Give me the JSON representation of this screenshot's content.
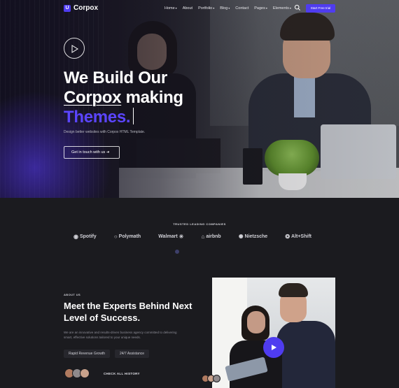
{
  "nav": {
    "logo_mark": "U",
    "logo": "Corpox",
    "items": [
      {
        "label": "Home",
        "dropdown": true
      },
      {
        "label": "About",
        "dropdown": false
      },
      {
        "label": "Portfolio",
        "dropdown": true
      },
      {
        "label": "Blog",
        "dropdown": true
      },
      {
        "label": "Contact",
        "dropdown": false
      },
      {
        "label": "Pages",
        "dropdown": true
      },
      {
        "label": "Elements",
        "dropdown": true
      }
    ],
    "cta": "Start Free trial"
  },
  "hero": {
    "line1": "We Build Our",
    "line2_underlined": "Corpox",
    "line2_rest": " making",
    "line3": "Themes.",
    "subtitle": "Design better websites with Corpox HTML Template.",
    "button": "Get in touch with us"
  },
  "companies": {
    "label": "TRUSTED LEADING COMPANIES",
    "brands": [
      "Spotify",
      "Polymath",
      "Walmart",
      "airbnb",
      "Nietzsche",
      "Alt+Shift"
    ]
  },
  "about": {
    "label": "ABOUT US",
    "title": "Meet the Experts Behind Next Level of Success.",
    "text": "We are an innovative and results-driven business agency committed to delivering smart, effective solutions tailored to your unique needs.",
    "tags": [
      "Rapid Revenue Growth",
      "24/7 Assistance"
    ],
    "history": "CHECK ALL HISTORY"
  },
  "colors": {
    "accent": "#4f3cf0",
    "background": "#1b1b1f"
  }
}
